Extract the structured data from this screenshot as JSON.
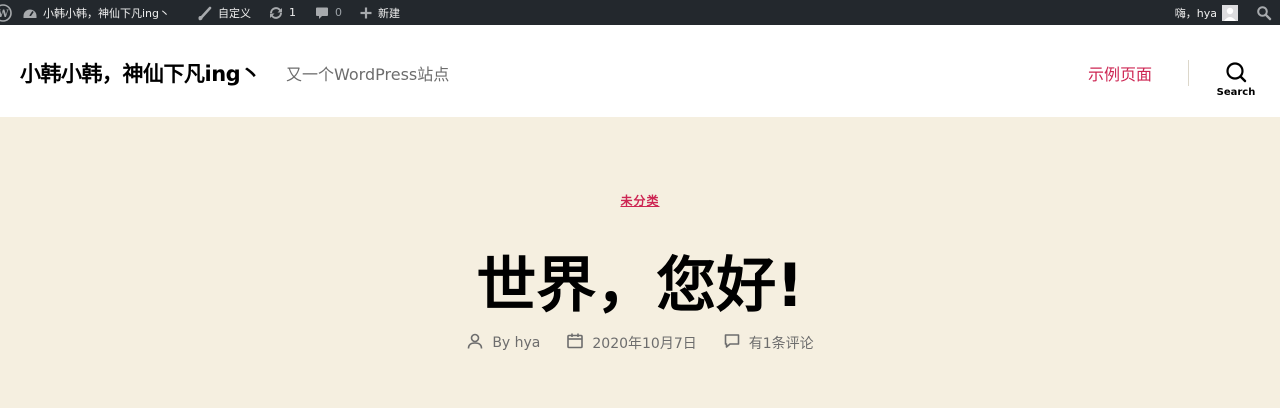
{
  "admin_bar": {
    "site_name": "小韩小韩，神仙下凡ing丶",
    "customize": "自定义",
    "updates_count": "1",
    "comments_count": "0",
    "new_label": "新建",
    "account_greeting": "嗨，hya"
  },
  "header": {
    "site_title": "小韩小韩，神仙下凡ing丶",
    "site_description": "又一个WordPress站点",
    "menu_item": "示例页面",
    "search_label": "Search"
  },
  "post": {
    "category": "未分类",
    "title": "世界，您好!",
    "author": "By hya",
    "date": "2020年10月7日",
    "comments": "有1条评论"
  },
  "colors": {
    "accent": "#cd2653",
    "admin_bar_bg": "#23282d",
    "header_bg": "#ffffff",
    "page_bg": "#f5efe0"
  }
}
